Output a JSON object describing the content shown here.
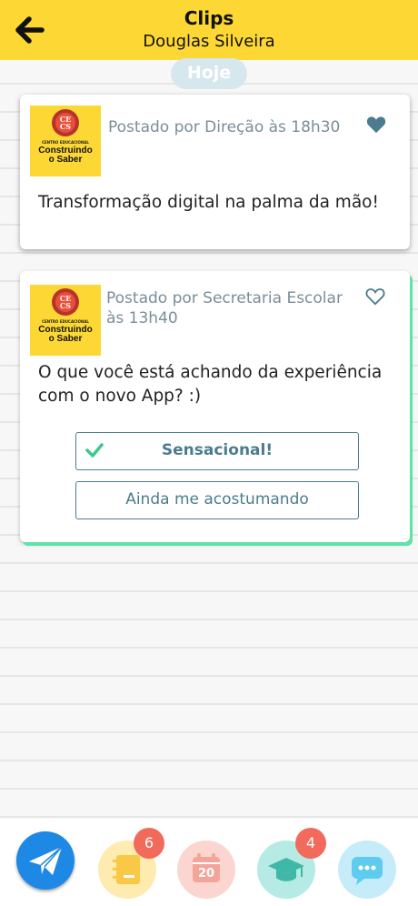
{
  "header": {
    "title": "Clips",
    "subtitle": "Douglas Silveira"
  },
  "day_label": "Hoje",
  "logo": {
    "small_text": "CENTRO EDUCACIONAL",
    "big_text": "Construindo\no Saber",
    "emblem_text": "CECS"
  },
  "posts": [
    {
      "meta": "Postado por Direção às 18h30",
      "message": "Transformação digital na palma da mão!",
      "liked": true
    },
    {
      "meta": "Postado por Secretaria Escolar às 13h40",
      "message": "O que você está achando da experiência com o novo App? :)",
      "liked": false,
      "options": [
        {
          "label": "Sensacional!",
          "selected": true
        },
        {
          "label": "Ainda me acostumando",
          "selected": false
        }
      ]
    }
  ],
  "bottom_nav": [
    {
      "icon": "paper-plane-icon",
      "badge": null
    },
    {
      "icon": "notebook-icon",
      "badge": "6"
    },
    {
      "icon": "calendar-icon",
      "badge": null,
      "calendar_day": "20"
    },
    {
      "icon": "graduation-cap-icon",
      "badge": "4"
    },
    {
      "icon": "chat-bubble-icon",
      "badge": null
    }
  ],
  "colors": {
    "header_bg": "#fdd835",
    "accent_green": "#5ee3a9",
    "meta_text": "#7a8e99",
    "button_border": "#4b7c8e",
    "badge": "#f26a5b"
  }
}
